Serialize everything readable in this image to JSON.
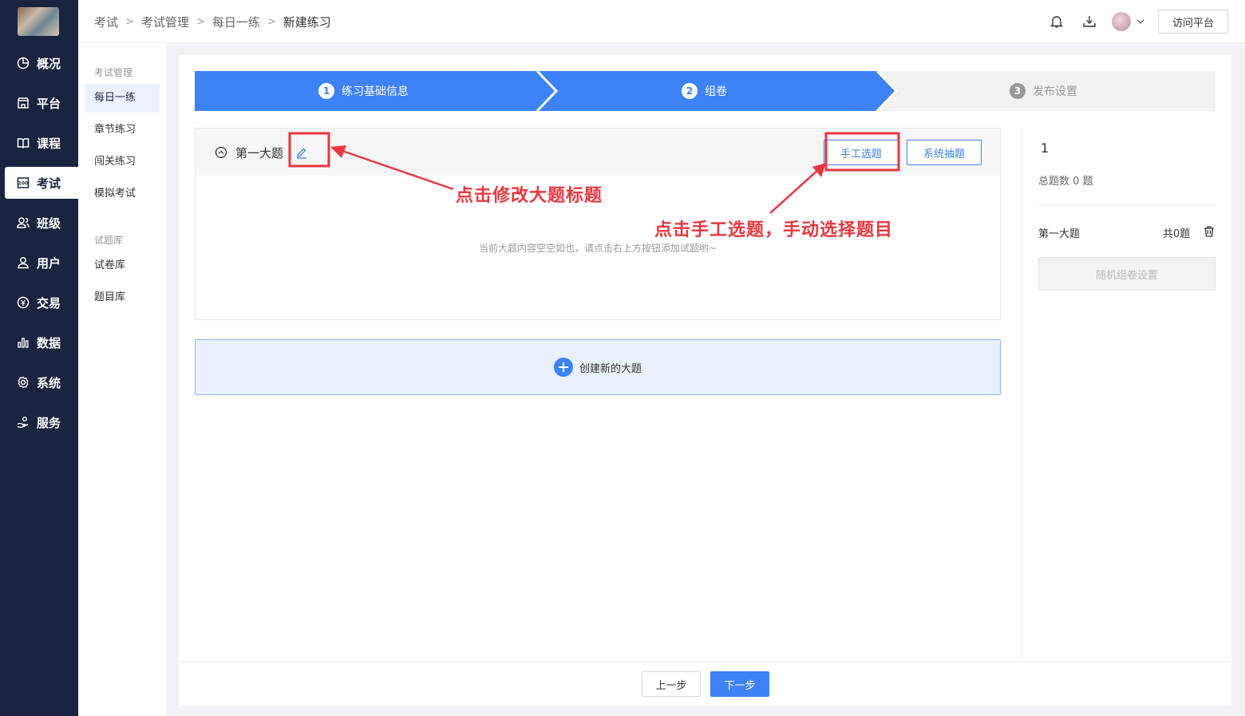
{
  "nav": {
    "items": [
      {
        "label": "概况",
        "icon": "pie-chart-icon"
      },
      {
        "label": "平台",
        "icon": "store-icon"
      },
      {
        "label": "课程",
        "icon": "book-icon"
      },
      {
        "label": "考试",
        "icon": "exam-100-icon"
      },
      {
        "label": "班级",
        "icon": "users-icon"
      },
      {
        "label": "用户",
        "icon": "user-icon"
      },
      {
        "label": "交易",
        "icon": "trade-icon"
      },
      {
        "label": "数据",
        "icon": "bar-chart-icon"
      },
      {
        "label": "系统",
        "icon": "gear-icon"
      },
      {
        "label": "服务",
        "icon": "service-hand-icon"
      }
    ],
    "active_index": 3
  },
  "subnav": {
    "group1": "考试管理",
    "group1_items": [
      "每日一练",
      "章节练习",
      "闯关练习",
      "模拟考试"
    ],
    "group2": "试题库",
    "group2_items": [
      "试卷库",
      "题目库"
    ]
  },
  "header": {
    "breadcrumb": [
      "考试",
      "考试管理",
      "每日一练",
      "新建练习"
    ],
    "visit_label": "访问平台"
  },
  "steps": [
    {
      "num": "1",
      "label": "练习基础信息",
      "state": "done"
    },
    {
      "num": "2",
      "label": "组卷",
      "state": "active"
    },
    {
      "num": "3",
      "label": "发布设置",
      "state": "pending"
    }
  ],
  "section": {
    "title": "第一大题",
    "manual_label": "手工选题",
    "system_label": "系统抽题",
    "empty_tip": "当前大题内容空空如也，请点击右上方按钮添加试题哟~"
  },
  "create_label": "创建新的大题",
  "summary": {
    "index": "1",
    "total": "总题数 0 题",
    "section_name": "第一大题",
    "section_count": "共0题",
    "random_label": "随机组卷设置"
  },
  "footer": {
    "prev_label": "上一步",
    "next_label": "下一步"
  },
  "annotations": {
    "edit_hint": "点击修改大题标题",
    "manual_hint": "点击手工选题，手动选择题目"
  },
  "colors": {
    "nav_bg": "#1a2340",
    "primary": "#3e82f7",
    "annotation": "#e8373f"
  }
}
